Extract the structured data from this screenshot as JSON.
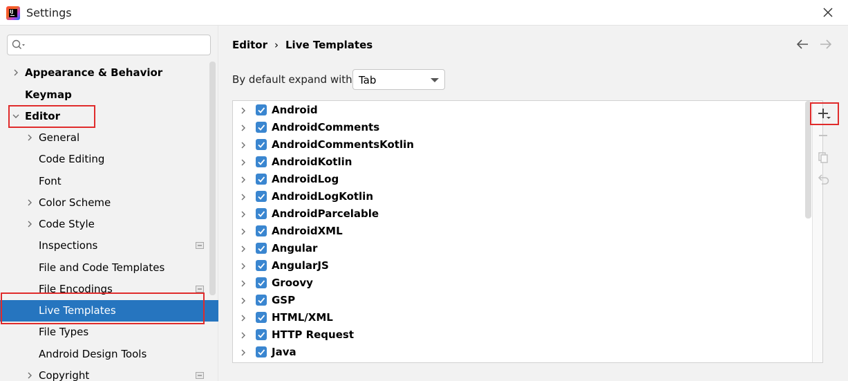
{
  "window": {
    "title": "Settings"
  },
  "search": {
    "placeholder": ""
  },
  "sidebar": {
    "items": [
      {
        "label": "Appearance & Behavior"
      },
      {
        "label": "Keymap"
      },
      {
        "label": "Editor"
      },
      {
        "label": "General"
      },
      {
        "label": "Code Editing"
      },
      {
        "label": "Font"
      },
      {
        "label": "Color Scheme"
      },
      {
        "label": "Code Style"
      },
      {
        "label": "Inspections"
      },
      {
        "label": "File and Code Templates"
      },
      {
        "label": "File Encodings"
      },
      {
        "label": "Live Templates"
      },
      {
        "label": "File Types"
      },
      {
        "label": "Android Design Tools"
      },
      {
        "label": "Copyright"
      }
    ]
  },
  "main": {
    "breadcrumb": {
      "parent": "Editor",
      "separator": "›",
      "current": "Live Templates"
    },
    "expand": {
      "label": "By default expand with",
      "value": "Tab"
    },
    "templates": [
      {
        "name": "Android",
        "checked": true
      },
      {
        "name": "AndroidComments",
        "checked": true
      },
      {
        "name": "AndroidCommentsKotlin",
        "checked": true
      },
      {
        "name": "AndroidKotlin",
        "checked": true
      },
      {
        "name": "AndroidLog",
        "checked": true
      },
      {
        "name": "AndroidLogKotlin",
        "checked": true
      },
      {
        "name": "AndroidParcelable",
        "checked": true
      },
      {
        "name": "AndroidXML",
        "checked": true
      },
      {
        "name": "Angular",
        "checked": true
      },
      {
        "name": "AngularJS",
        "checked": true
      },
      {
        "name": "Groovy",
        "checked": true
      },
      {
        "name": "GSP",
        "checked": true
      },
      {
        "name": "HTML/XML",
        "checked": true
      },
      {
        "name": "HTTP Request",
        "checked": true
      },
      {
        "name": "Java",
        "checked": true
      }
    ]
  },
  "colors": {
    "accent": "#2675bf",
    "checkbox": "#3a86d0",
    "highlight": "#e02b2b"
  },
  "icons": [
    "search-icon",
    "close-icon",
    "back-arrow-icon",
    "forward-arrow-icon",
    "add-icon",
    "remove-icon",
    "copy-icon",
    "restore-icon",
    "chevron-right-icon",
    "chevron-down-icon"
  ]
}
